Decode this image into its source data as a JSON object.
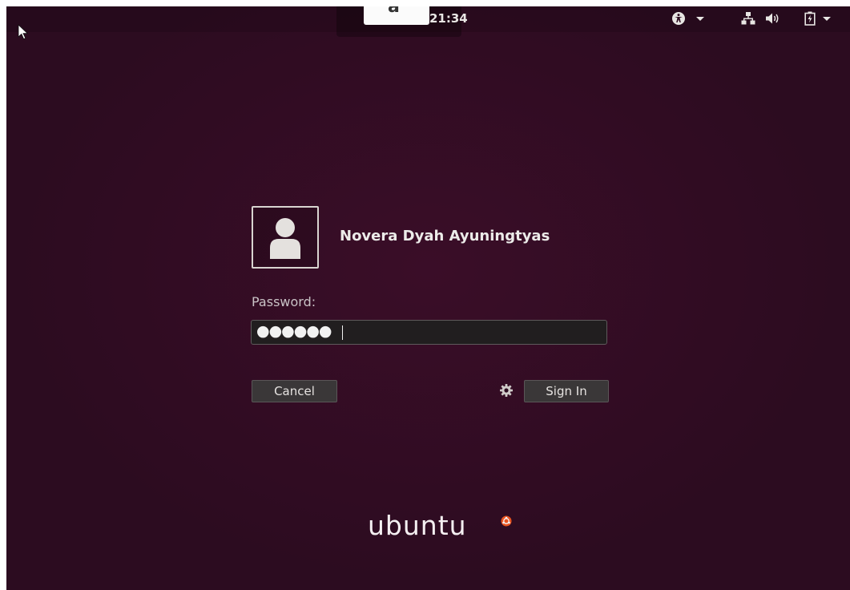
{
  "topbar": {
    "clock": "21:34",
    "popup_glyph": "a",
    "icons": [
      "accessibility-icon",
      "chevron-down-icon",
      "network-icon",
      "volume-icon",
      "battery-icon",
      "chevron-down-icon"
    ]
  },
  "user": {
    "name": "Novera Dyah Ayuningtyas",
    "avatar_icon": "user-silhouette-icon"
  },
  "password": {
    "label": "Password:",
    "masked_value": "●●●●●●"
  },
  "buttons": {
    "cancel": "Cancel",
    "sign_in": "Sign In",
    "session_icon": "gear-icon"
  },
  "branding": {
    "logo_text": "ubuntu"
  },
  "colors": {
    "background": "#2c0c20",
    "field": "#211e1f",
    "button": "#3a3738",
    "accent": "#e95420"
  }
}
